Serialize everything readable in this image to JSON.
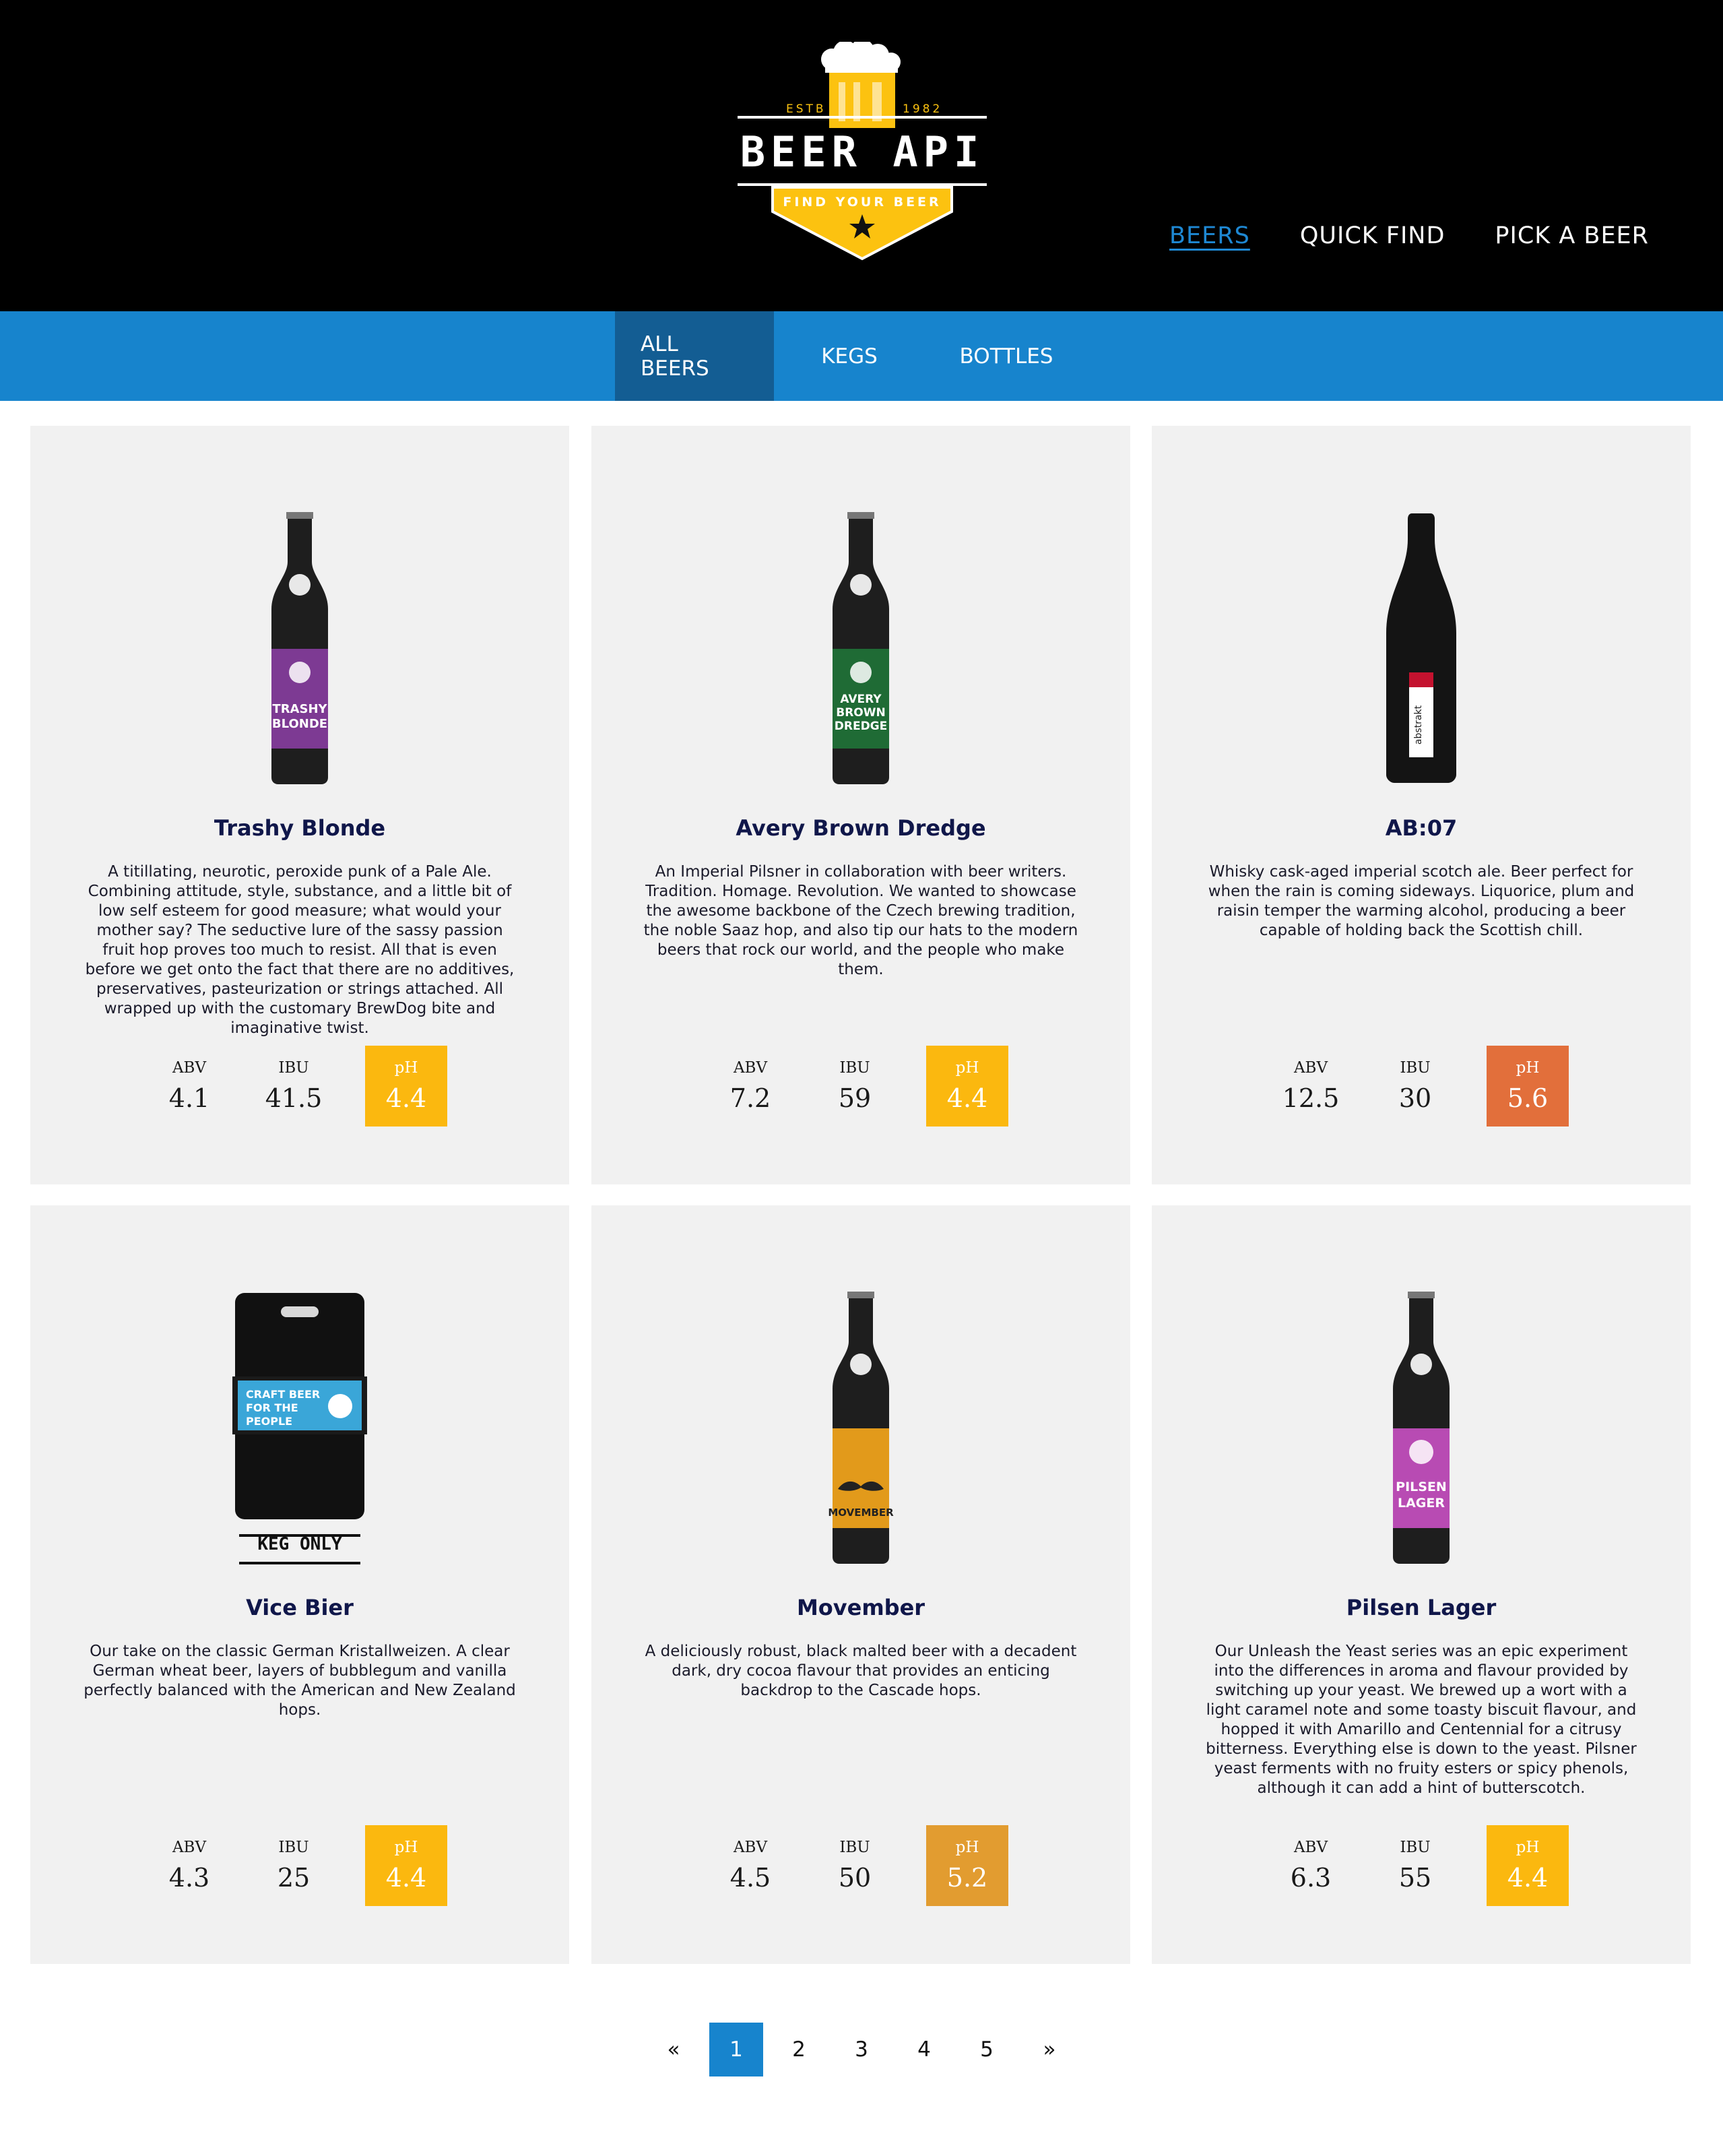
{
  "header": {
    "logo": {
      "estb": "ESTB",
      "year": "1982",
      "title": "BEER API",
      "tagline": "FIND YOUR BEER",
      "icon": "beer-mug-icon"
    },
    "nav": [
      "BEERS",
      "QUICK  FIND",
      "PICK A BEER"
    ]
  },
  "subnav": [
    "ALL BEERS",
    "KEGS",
    "BOTTLES"
  ],
  "beers": [
    {
      "name": "Trashy Blonde",
      "description": "A titillating, neurotic, peroxide punk of a Pale Ale. Combining attitude, style, substance, and a little bit of low self esteem for good measure; what would your mother say? The seductive lure of the sassy passion fruit hop proves too much to resist. All that is even before we get onto the fact that there are no additives, preservatives, pasteurization or strings attached. All wrapped up with the customary BrewDog bite and imaginative twist.",
      "abv_label": "ABV",
      "abv": "4.1",
      "ibu_label": "IBU",
      "ibu": "41.5",
      "ph_label": "pH",
      "ph": "4.4",
      "ph_color": "#fbb80f",
      "bottle_label": "TRASHY BLONDE",
      "label_color": "#7d3a93"
    },
    {
      "name": "Avery Brown Dredge",
      "description": "An Imperial Pilsner in collaboration with beer writers. Tradition. Homage. Revolution. We wanted to showcase the awesome backbone of the Czech brewing tradition, the noble Saaz hop, and also tip our hats to the modern beers that rock our world, and the people who make them.",
      "abv_label": "ABV",
      "abv": "7.2",
      "ibu_label": "IBU",
      "ibu": "59",
      "ph_label": "pH",
      "ph": "4.4",
      "ph_color": "#fbb80f",
      "bottle_label": "AVERY BROWN DREDGE",
      "label_color": "#1f6b35"
    },
    {
      "name": "AB:07",
      "description": "Whisky cask-aged imperial scotch ale. Beer perfect for when the rain is coming sideways. Liquorice, plum and raisin temper the warming alcohol, producing a beer capable of holding back the Scottish chill.",
      "abv_label": "ABV",
      "abv": "12.5",
      "ibu_label": "IBU",
      "ibu": "30",
      "ph_label": "pH",
      "ph": "5.6",
      "ph_color": "#e26f3b",
      "bottle_label": "abstrakt",
      "label_color": "#ffffff"
    },
    {
      "name": "Vice Bier",
      "description": "Our take on the classic German Kristallweizen. A clear German wheat beer, layers of bubblegum and vanilla perfectly balanced with the American and New Zealand hops.",
      "abv_label": "ABV",
      "abv": "4.3",
      "ibu_label": "IBU",
      "ibu": "25",
      "ph_label": "pH",
      "ph": "4.4",
      "ph_color": "#fbb80f",
      "bottle_label": "CRAFT BEER FOR THE PEOPLE",
      "keg_tag": "KEG ONLY",
      "label_color": "#3aa6d8"
    },
    {
      "name": "Movember",
      "description": "A deliciously robust, black malted beer with a decadent dark, dry cocoa flavour that provides an enticing backdrop to the Cascade hops.",
      "abv_label": "ABV",
      "abv": "4.5",
      "ibu_label": "IBU",
      "ibu": "50",
      "ph_label": "pH",
      "ph": "5.2",
      "ph_color": "#e29c30",
      "bottle_label": "MOVEMBER",
      "label_color": "#e29a1b"
    },
    {
      "name": "Pilsen Lager",
      "description": "Our Unleash the Yeast series was an epic experiment into the differences in aroma and flavour provided by switching up your yeast. We brewed up a wort with a light caramel note and some toasty biscuit flavour, and hopped it with Amarillo and Centennial for a citrusy bitterness. Everything else is down to the yeast. Pilsner yeast ferments with no fruity esters or spicy phenols, although it can add a hint of butterscotch.",
      "abv_label": "ABV",
      "abv": "6.3",
      "ibu_label": "IBU",
      "ibu": "55",
      "ph_label": "pH",
      "ph": "4.4",
      "ph_color": "#fbb80f",
      "bottle_label": "PILSEN LAGER",
      "label_color": "#b84bb3"
    }
  ],
  "pagination": {
    "prev": "«",
    "pages": [
      "1",
      "2",
      "3",
      "4",
      "5"
    ],
    "current": "1",
    "next": "»"
  },
  "colors": {
    "header_bg": "#000000",
    "subnav_bg": "#1784cd",
    "subnav_active": "#135d93",
    "card_bg": "#f1f1f1",
    "title_color": "#10174a",
    "logo_yellow": "#fcc210"
  }
}
